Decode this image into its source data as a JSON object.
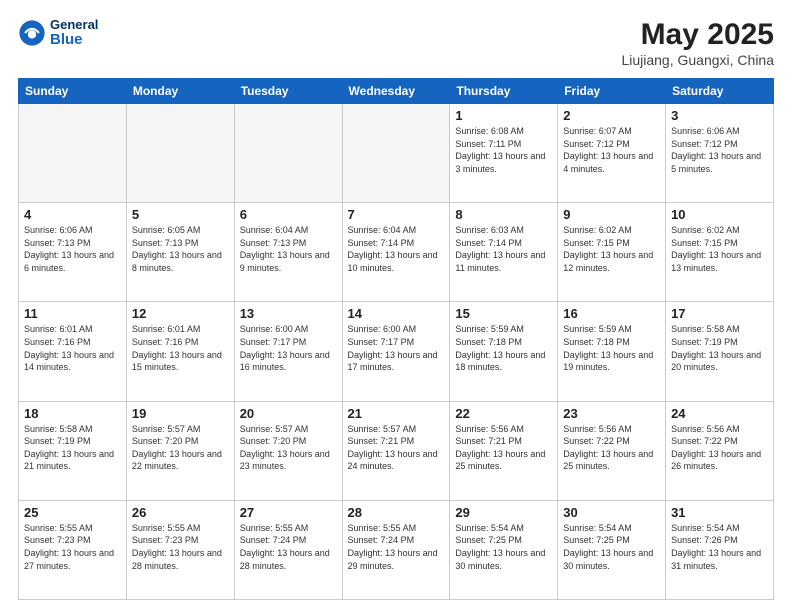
{
  "header": {
    "logo": {
      "general": "General",
      "blue": "Blue"
    },
    "title": "May 2025",
    "location": "Liujiang, Guangxi, China"
  },
  "weekdays": [
    "Sunday",
    "Monday",
    "Tuesday",
    "Wednesday",
    "Thursday",
    "Friday",
    "Saturday"
  ],
  "weeks": [
    [
      {
        "day": "",
        "empty": true
      },
      {
        "day": "",
        "empty": true
      },
      {
        "day": "",
        "empty": true
      },
      {
        "day": "",
        "empty": true
      },
      {
        "day": "1",
        "sunrise": "6:08 AM",
        "sunset": "7:11 PM",
        "daylight": "13 hours and 3 minutes."
      },
      {
        "day": "2",
        "sunrise": "6:07 AM",
        "sunset": "7:12 PM",
        "daylight": "13 hours and 4 minutes."
      },
      {
        "day": "3",
        "sunrise": "6:06 AM",
        "sunset": "7:12 PM",
        "daylight": "13 hours and 5 minutes."
      }
    ],
    [
      {
        "day": "4",
        "sunrise": "6:06 AM",
        "sunset": "7:13 PM",
        "daylight": "13 hours and 6 minutes."
      },
      {
        "day": "5",
        "sunrise": "6:05 AM",
        "sunset": "7:13 PM",
        "daylight": "13 hours and 8 minutes."
      },
      {
        "day": "6",
        "sunrise": "6:04 AM",
        "sunset": "7:13 PM",
        "daylight": "13 hours and 9 minutes."
      },
      {
        "day": "7",
        "sunrise": "6:04 AM",
        "sunset": "7:14 PM",
        "daylight": "13 hours and 10 minutes."
      },
      {
        "day": "8",
        "sunrise": "6:03 AM",
        "sunset": "7:14 PM",
        "daylight": "13 hours and 11 minutes."
      },
      {
        "day": "9",
        "sunrise": "6:02 AM",
        "sunset": "7:15 PM",
        "daylight": "13 hours and 12 minutes."
      },
      {
        "day": "10",
        "sunrise": "6:02 AM",
        "sunset": "7:15 PM",
        "daylight": "13 hours and 13 minutes."
      }
    ],
    [
      {
        "day": "11",
        "sunrise": "6:01 AM",
        "sunset": "7:16 PM",
        "daylight": "13 hours and 14 minutes."
      },
      {
        "day": "12",
        "sunrise": "6:01 AM",
        "sunset": "7:16 PM",
        "daylight": "13 hours and 15 minutes."
      },
      {
        "day": "13",
        "sunrise": "6:00 AM",
        "sunset": "7:17 PM",
        "daylight": "13 hours and 16 minutes."
      },
      {
        "day": "14",
        "sunrise": "6:00 AM",
        "sunset": "7:17 PM",
        "daylight": "13 hours and 17 minutes."
      },
      {
        "day": "15",
        "sunrise": "5:59 AM",
        "sunset": "7:18 PM",
        "daylight": "13 hours and 18 minutes."
      },
      {
        "day": "16",
        "sunrise": "5:59 AM",
        "sunset": "7:18 PM",
        "daylight": "13 hours and 19 minutes."
      },
      {
        "day": "17",
        "sunrise": "5:58 AM",
        "sunset": "7:19 PM",
        "daylight": "13 hours and 20 minutes."
      }
    ],
    [
      {
        "day": "18",
        "sunrise": "5:58 AM",
        "sunset": "7:19 PM",
        "daylight": "13 hours and 21 minutes."
      },
      {
        "day": "19",
        "sunrise": "5:57 AM",
        "sunset": "7:20 PM",
        "daylight": "13 hours and 22 minutes."
      },
      {
        "day": "20",
        "sunrise": "5:57 AM",
        "sunset": "7:20 PM",
        "daylight": "13 hours and 23 minutes."
      },
      {
        "day": "21",
        "sunrise": "5:57 AM",
        "sunset": "7:21 PM",
        "daylight": "13 hours and 24 minutes."
      },
      {
        "day": "22",
        "sunrise": "5:56 AM",
        "sunset": "7:21 PM",
        "daylight": "13 hours and 25 minutes."
      },
      {
        "day": "23",
        "sunrise": "5:56 AM",
        "sunset": "7:22 PM",
        "daylight": "13 hours and 25 minutes."
      },
      {
        "day": "24",
        "sunrise": "5:56 AM",
        "sunset": "7:22 PM",
        "daylight": "13 hours and 26 minutes."
      }
    ],
    [
      {
        "day": "25",
        "sunrise": "5:55 AM",
        "sunset": "7:23 PM",
        "daylight": "13 hours and 27 minutes."
      },
      {
        "day": "26",
        "sunrise": "5:55 AM",
        "sunset": "7:23 PM",
        "daylight": "13 hours and 28 minutes."
      },
      {
        "day": "27",
        "sunrise": "5:55 AM",
        "sunset": "7:24 PM",
        "daylight": "13 hours and 28 minutes."
      },
      {
        "day": "28",
        "sunrise": "5:55 AM",
        "sunset": "7:24 PM",
        "daylight": "13 hours and 29 minutes."
      },
      {
        "day": "29",
        "sunrise": "5:54 AM",
        "sunset": "7:25 PM",
        "daylight": "13 hours and 30 minutes."
      },
      {
        "day": "30",
        "sunrise": "5:54 AM",
        "sunset": "7:25 PM",
        "daylight": "13 hours and 30 minutes."
      },
      {
        "day": "31",
        "sunrise": "5:54 AM",
        "sunset": "7:26 PM",
        "daylight": "13 hours and 31 minutes."
      }
    ]
  ]
}
